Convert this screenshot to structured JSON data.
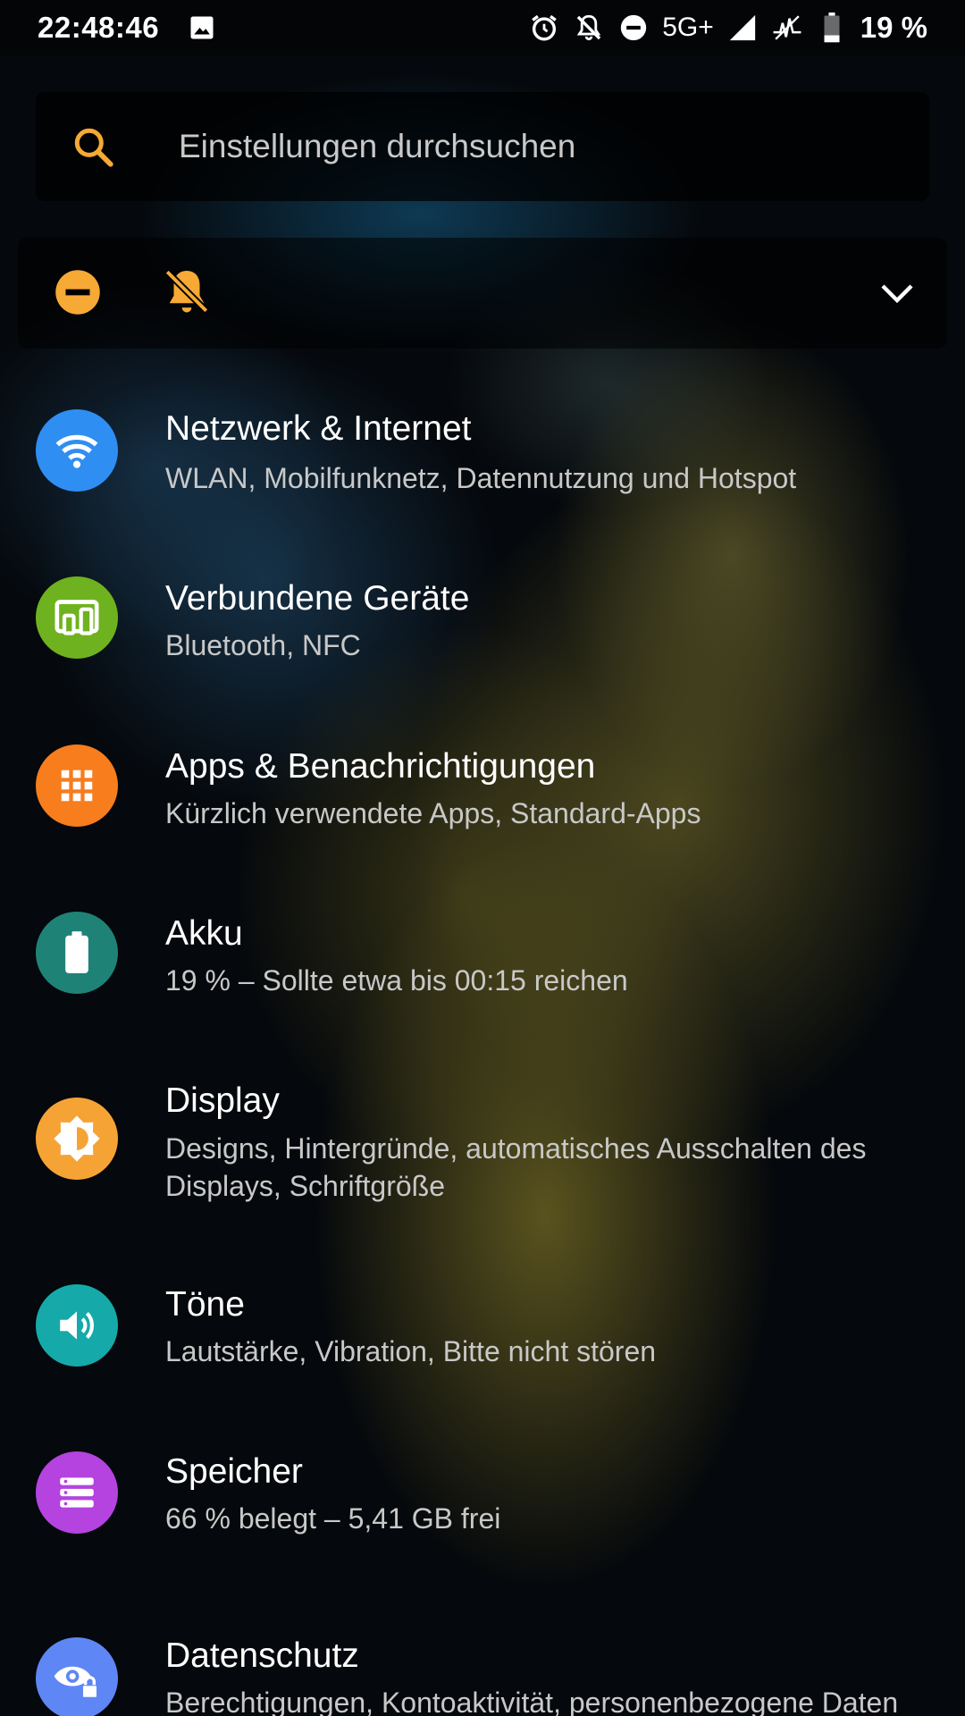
{
  "status_bar": {
    "time": "22:48:46",
    "network": "5G+",
    "battery": "19 %"
  },
  "search": {
    "placeholder": "Einstellungen durchsuchen"
  },
  "conditions": {
    "icons": [
      "do-not-disturb-icon",
      "bell-off-icon",
      "chevron-down-icon"
    ],
    "accent_color": "#f6a935"
  },
  "settings": [
    {
      "title": "Netzwerk & Internet",
      "summary": "WLAN, Mobilfunknetz, Datennutzung und Hotspot",
      "icon": "wifi-icon",
      "color": "#2f8ef2"
    },
    {
      "title": "Verbundene Geräte",
      "summary": "Bluetooth, NFC",
      "icon": "connected-devices-icon",
      "color": "#6fb21f"
    },
    {
      "title": "Apps & Benachrichtigungen",
      "summary": "Kürzlich verwendete Apps, Standard-Apps",
      "icon": "apps-grid-icon",
      "color": "#f77d1d"
    },
    {
      "title": "Akku",
      "summary": "19 % – Sollte etwa bis 00:15 reichen",
      "icon": "battery-icon",
      "color": "#1e8376"
    },
    {
      "title": "Display",
      "summary": "Designs, Hintergründe, automatisches Ausschalten des Displays, Schriftgröße",
      "icon": "brightness-icon",
      "color": "#f6a335"
    },
    {
      "title": "Töne",
      "summary": "Lautstärke, Vibration, Bitte nicht stören",
      "icon": "volume-icon",
      "color": "#15aaa9"
    },
    {
      "title": "Speicher",
      "summary": "66 % belegt – 5,41 GB frei",
      "icon": "storage-icon",
      "color": "#b443e0"
    },
    {
      "title": "Datenschutz",
      "summary": "Berechtigungen, Kontoaktivität, personenbezogene Daten",
      "icon": "privacy-eye-icon",
      "color": "#5e87f5"
    }
  ]
}
